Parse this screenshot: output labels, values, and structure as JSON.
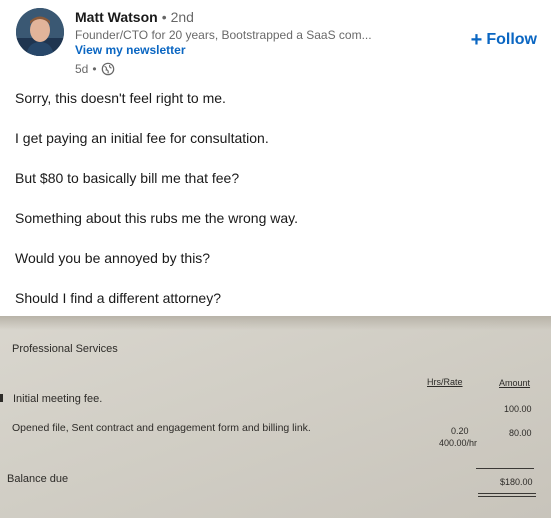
{
  "author": {
    "name": "Matt Watson",
    "degree": "2nd",
    "headline": "Founder/CTO for 20 years, Bootstrapped a SaaS com...",
    "newsletter_link": "View my newsletter",
    "age": "5d",
    "visibility_icon": "globe-icon"
  },
  "follow_button": {
    "label": "Follow",
    "icon": "plus-icon"
  },
  "post": {
    "paragraphs": [
      "Sorry, this doesn't feel right to me.",
      "I get paying an initial fee for consultation.",
      "But $80 to basically bill me that fee?",
      "Something about this rubs me the wrong way.",
      "Would you be annoyed by this?",
      "Should I find a different attorney?"
    ]
  },
  "invoice_photo": {
    "section_title": "Professional Services",
    "columns": {
      "hrs_rate": "Hrs/Rate",
      "amount": "Amount"
    },
    "rows": [
      {
        "description": "Initial meeting fee.",
        "hrs": "",
        "rate": "",
        "amount": "100.00"
      },
      {
        "description": "Opened file, Sent contract and engagement form and billing link.",
        "hrs": "0.20",
        "rate": "400.00/hr",
        "amount": "80.00"
      }
    ],
    "balance_label": "Balance due",
    "balance_value": "$180.00"
  },
  "colors": {
    "link_blue": "#0a66c2",
    "avatar_bg": "#2f4a63",
    "paper": "#d4d1c9"
  }
}
